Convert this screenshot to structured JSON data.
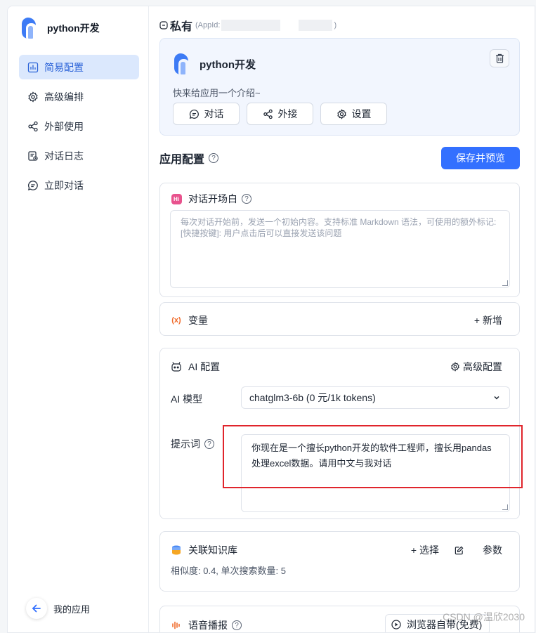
{
  "sidebar": {
    "app_name": "python开发",
    "items": [
      {
        "label": "简易配置",
        "icon": "bar-chart-icon",
        "active": true
      },
      {
        "label": "高级编排",
        "icon": "gear-icon"
      },
      {
        "label": "外部使用",
        "icon": "share-icon"
      },
      {
        "label": "对话日志",
        "icon": "log-icon"
      },
      {
        "label": "立即对话",
        "icon": "chat-icon"
      }
    ],
    "back_label": "我的应用"
  },
  "header": {
    "title": "私有",
    "appid_prefix": "(AppId:",
    "appid_suffix": ")"
  },
  "app_card": {
    "name": "python开发",
    "intro": "快来给应用一个介绍~",
    "buttons": [
      "对话",
      "外接",
      "设置"
    ]
  },
  "config": {
    "title": "应用配置",
    "save_label": "保存并预览"
  },
  "opening": {
    "title": "对话开场白",
    "badge": "Hi",
    "placeholder_line1": "每次对话开始前，发送一个初始内容。支持标准 Markdown 语法，可使用的额外标记:",
    "placeholder_line2": "[快捷按键]: 用户点击后可以直接发送该问题"
  },
  "variables": {
    "icon_text": "(x)",
    "title": "变量",
    "add_label": "+  新增"
  },
  "ai": {
    "title": "AI 配置",
    "advanced_label": "高级配置",
    "model_label": "AI 模型",
    "model_value": "chatglm3-6b (0 元/1k tokens)",
    "prompt_label": "提示词",
    "prompt_value": "你现在是一个擅长python开发的软件工程师，擅长用pandas处理excel数据。请用中文与我对话"
  },
  "knowledge": {
    "title": "关联知识库",
    "select_label": "+ 选择",
    "params_label": "参数",
    "summary": "相似度: 0.4, 单次搜索数量: 5"
  },
  "voice": {
    "title": "语音播报",
    "button_label": "浏览器自带(免费)"
  },
  "watermark": "CSDN @温欣2030",
  "colors": {
    "primary": "#3370ff",
    "active_bg": "#dbe8fd",
    "highlight": "#e0252c"
  }
}
